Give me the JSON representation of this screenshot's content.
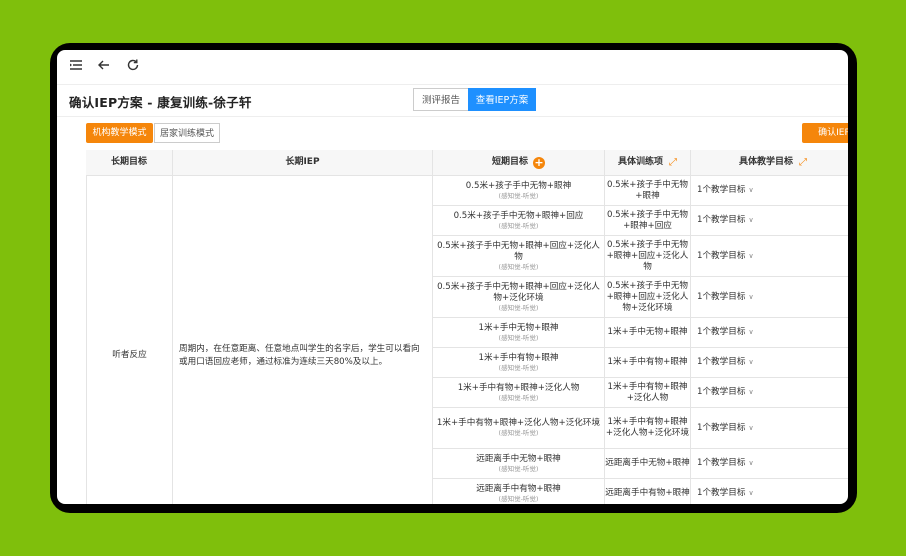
{
  "toolbar": {
    "menu_icon": "menu-icon",
    "back_icon": "back-arrow-icon",
    "refresh_icon": "refresh-icon"
  },
  "page": {
    "title": "确认IEP方案 - 康复训练-徐子轩"
  },
  "tabs": [
    {
      "label": "测评报告",
      "active": false
    },
    {
      "label": "查看IEP方案",
      "active": true
    }
  ],
  "modes": [
    {
      "label": "机构教学模式",
      "active": true
    },
    {
      "label": "居家训练模式",
      "active": false
    }
  ],
  "confirm_label": "确认IEP",
  "colors": {
    "accent_orange": "#f5860b",
    "accent_blue": "#1e90ff",
    "background": "#7fbf0c"
  },
  "table": {
    "headers": {
      "long_goal": "长期目标",
      "long_iep": "长期IEP",
      "short_goal": "短期目标",
      "training": "具体训练项",
      "teaching_goal": "具体教学目标"
    },
    "long_goal": "听者反应",
    "long_iep": "周期内，在任意距离、任意地点叫学生的名字后，学生可以看向或用口语回应老师，通过标准为连续三天80%及以上。",
    "rows": [
      {
        "short": "0.5米+孩子手中无物+眼神",
        "tag": "(感知觉-听觉)",
        "training": "0.5米+孩子手中无物+眼神",
        "goal": "1个教学目标"
      },
      {
        "short": "0.5米+孩子手中无物+眼神+回应",
        "tag": "(感知觉-听觉)",
        "training": "0.5米+孩子手中无物+眼神+回应",
        "goal": "1个教学目标"
      },
      {
        "short": "0.5米+孩子手中无物+眼神+回应+泛化人物",
        "tag": "(感知觉-听觉)",
        "training": "0.5米+孩子手中无物+眼神+回应+泛化人物",
        "goal": "1个教学目标"
      },
      {
        "short": "0.5米+孩子手中无物+眼神+回应+泛化人物+泛化环境",
        "tag": "(感知觉-听觉)",
        "training": "0.5米+孩子手中无物+眼神+回应+泛化人物+泛化环境",
        "goal": "1个教学目标"
      },
      {
        "short": "1米+手中无物+眼神",
        "tag": "(感知觉-听觉)",
        "training": "1米+手中无物+眼神",
        "goal": "1个教学目标"
      },
      {
        "short": "1米+手中有物+眼神",
        "tag": "(感知觉-听觉)",
        "training": "1米+手中有物+眼神",
        "goal": "1个教学目标"
      },
      {
        "short": "1米+手中有物+眼神+泛化人物",
        "tag": "(感知觉-听觉)",
        "training": "1米+手中有物+眼神+泛化人物",
        "goal": "1个教学目标"
      },
      {
        "short": "1米+手中有物+眼神+泛化人物+泛化环境",
        "tag": "(感知觉-听觉)",
        "training": "1米+手中有物+眼神+泛化人物+泛化环境",
        "goal": "1个教学目标"
      },
      {
        "short": "远距离手中无物+眼神",
        "tag": "(感知觉-听觉)",
        "training": "远距离手中无物+眼神",
        "goal": "1个教学目标"
      },
      {
        "short": "远距离手中有物+眼神",
        "tag": "(感知觉-听觉)",
        "training": "远距离手中有物+眼神",
        "goal": "1个教学目标"
      }
    ]
  }
}
